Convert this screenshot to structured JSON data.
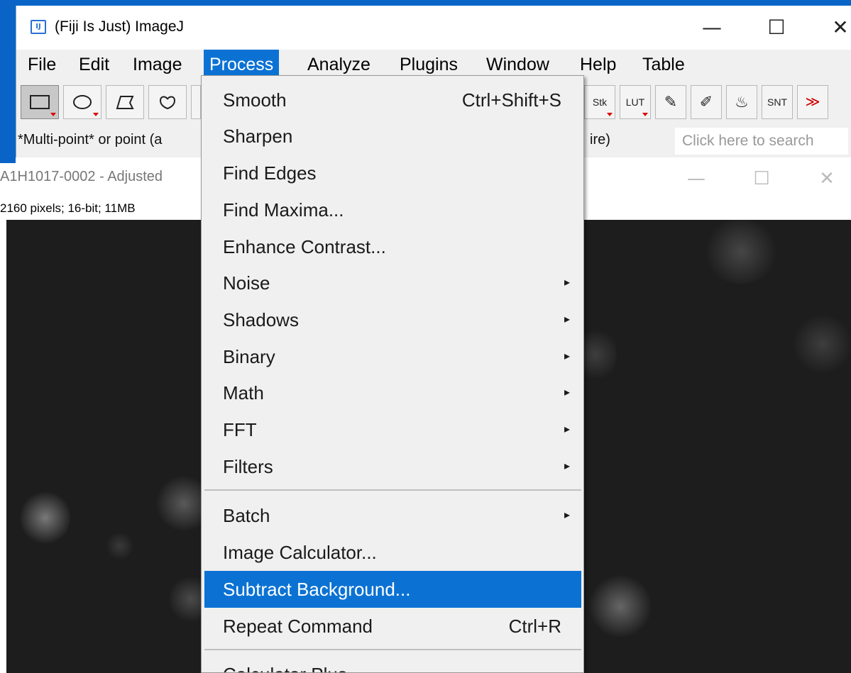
{
  "window": {
    "title": "(Fiji Is Just) ImageJ",
    "icon_text": "IJ",
    "minimize": "—",
    "maximize": "☐",
    "close": "✕"
  },
  "menubar": [
    {
      "label": "File"
    },
    {
      "label": "Edit"
    },
    {
      "label": "Image"
    },
    {
      "label": "Process"
    },
    {
      "label": "Analyze"
    },
    {
      "label": "Plugins"
    },
    {
      "label": "Window"
    },
    {
      "label": "Help"
    },
    {
      "label": "Table"
    }
  ],
  "toolbar": {
    "tools": [
      {
        "icon": "rectangle-icon"
      },
      {
        "icon": "oval-icon"
      },
      {
        "icon": "polygon-icon"
      },
      {
        "icon": "freehand-icon"
      }
    ],
    "right_tools": [
      {
        "icon": "stk-icon",
        "text": "Stk"
      },
      {
        "icon": "lut-icon",
        "text": "LUT"
      },
      {
        "icon": "pencil-icon",
        "text": "✎"
      },
      {
        "icon": "brush-icon",
        "text": "✐"
      },
      {
        "icon": "flood-fill-icon",
        "text": "♨"
      },
      {
        "icon": "snt-icon",
        "text": "SNT"
      },
      {
        "icon": "more-tools-icon",
        "text": "≫"
      }
    ]
  },
  "status": {
    "text": "*Multi-point* or point (a",
    "tail": "ire)",
    "search_placeholder": "Click here to search"
  },
  "image_window": {
    "title": "A1H1017-0002 - Adjusted",
    "info": "2160 pixels; 16-bit; 11MB",
    "minimize": "—",
    "maximize": "☐",
    "close": "✕"
  },
  "process_menu": {
    "items": [
      {
        "label": "Smooth",
        "shortcut": "Ctrl+Shift+S"
      },
      {
        "label": "Sharpen"
      },
      {
        "label": "Find Edges"
      },
      {
        "label": "Find Maxima..."
      },
      {
        "label": "Enhance Contrast..."
      },
      {
        "label": "Noise",
        "arrow": "▸"
      },
      {
        "label": "Shadows",
        "arrow": "▸"
      },
      {
        "label": "Binary",
        "arrow": "▸"
      },
      {
        "label": "Math",
        "arrow": "▸"
      },
      {
        "label": "FFT",
        "arrow": "▸"
      },
      {
        "label": "Filters",
        "arrow": "▸"
      },
      {
        "label": "Batch",
        "arrow": "▸"
      },
      {
        "label": "Image Calculator..."
      },
      {
        "label": "Subtract Background...",
        "highlighted": true
      },
      {
        "label": "Repeat Command",
        "shortcut": "Ctrl+R"
      },
      {
        "label": "Calculator Plus"
      }
    ]
  },
  "colors": {
    "accent": "#0b72d4",
    "menu_bg": "#f0f0f0",
    "image_bg": "#1d1d1d"
  }
}
